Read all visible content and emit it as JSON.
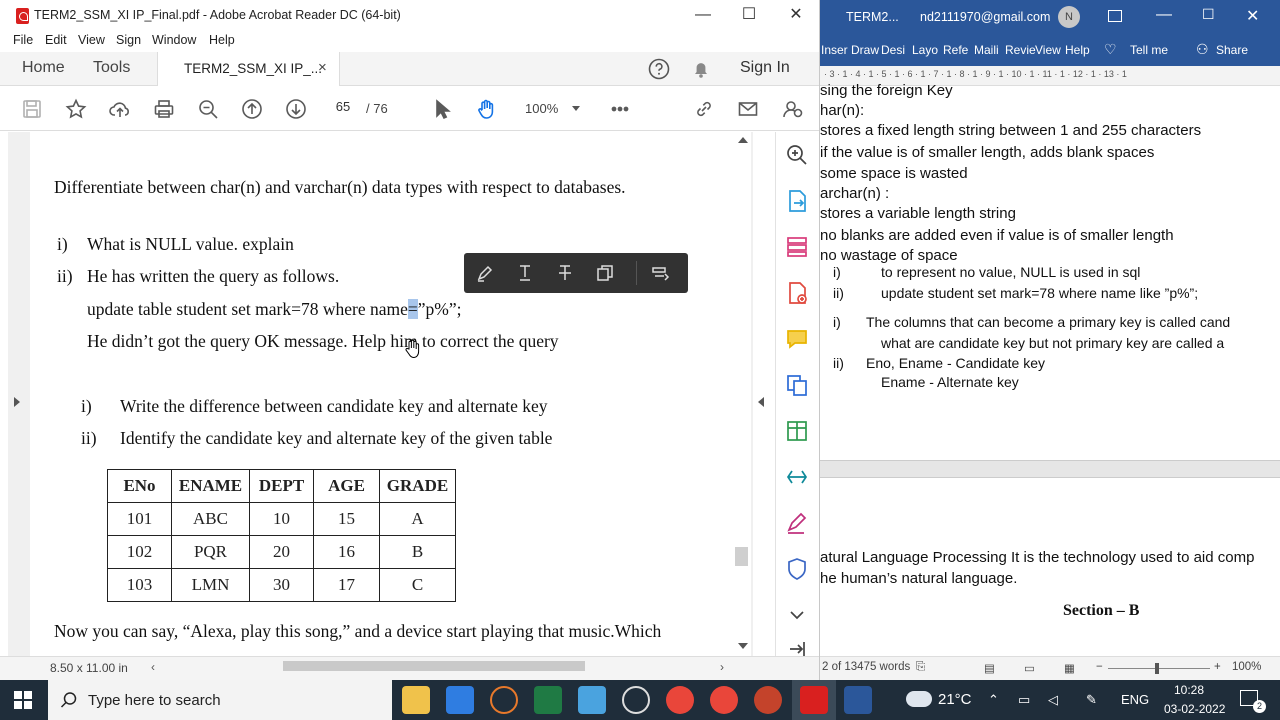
{
  "acrobat": {
    "title": "TERM2_SSM_XI IP_Final.pdf - Adobe Acrobat Reader DC (64-bit)",
    "menu": [
      "File",
      "Edit",
      "View",
      "Sign",
      "Window",
      "Help"
    ],
    "tabs": {
      "home": "Home",
      "tools": "Tools",
      "doc": "TERM2_SSM_XI IP_...",
      "close": "×"
    },
    "sign_in": "Sign In",
    "page_current": "65",
    "page_total": "/ 76",
    "zoom": "100%",
    "page_size": "8.50 x 11.00 in",
    "window_controls": {
      "minimize": "—",
      "maximize": "☐",
      "close": "✕"
    }
  },
  "pdf": {
    "q_diff": "Differentiate between char(n) and varchar(n) data types with respect to databases.",
    "q_i": "i)",
    "q_i_text": "What is NULL value. explain",
    "q_ii": "ii)",
    "q_ii_text": "He has written the query as follows.",
    "q_query_a": "update table student set mark=78 where name",
    "q_query_eq": "=",
    "q_query_b": "”p%”;",
    "q_help": "He didn’t got the query OK message. Help him to correct the query",
    "q2_i": "i)",
    "q2_i_text": "Write the difference between candidate key and alternate key",
    "q2_ii": "ii)",
    "q2_ii_text": "Identify the candidate key and alternate key of the given table",
    "table": {
      "headers": [
        "ENo",
        "ENAME",
        "DEPT",
        "AGE",
        "GRADE"
      ],
      "rows": [
        [
          "101",
          "ABC",
          "10",
          "15",
          "A"
        ],
        [
          "102",
          "PQR",
          "20",
          "16",
          "B"
        ],
        [
          "103",
          "LMN",
          "30",
          "17",
          "C"
        ]
      ]
    },
    "q_alexa": "Now you can say, “Alexa, play this song,” and a device start playing that music.Which"
  },
  "word": {
    "title": "TERM2...",
    "account": "nd2111970@gmail.com",
    "avatar": "N",
    "ribbon": [
      "Inser",
      "Draw",
      "Desi",
      "Layo",
      "Refe",
      "Maili",
      "Revie",
      "View",
      "Help"
    ],
    "tell_me": "Tell me",
    "share": "Share",
    "ruler": "· 3 · 1 · 4 · 1 · 5 · 1 · 6 · 1 · 7 · 1 · 8 · 1 · 9 · 1 · 10 · 1 · 11 · 1 · 12 · 1 · 13 · 1",
    "lines": {
      "l1": "sing the foreign Key",
      "l2": "har(n):",
      "l3": "stores a fixed length string between 1 and 255 characters",
      "l4": "if the value is of smaller length, adds blank spaces",
      "l5": "some space is wasted",
      "l6": "archar(n) :",
      "l7": "stores a variable length string",
      "l8": "no blanks are added even if value is of smaller length",
      "l9": "no wastage of space",
      "a1n": "i)",
      "a1": "to represent no value, NULL is used in sql",
      "a2n": "ii)",
      "a2": "update student set mark=78 where name like ”p%”;",
      "b1n": "i)",
      "b1": "The columns that can become a primary key is called cand",
      "b1b": "what are candidate key but not primary key are called a",
      "b2n": "ii)",
      "b2": "Eno, Ename - Candidate key",
      "b2b": "Ename - Alternate key",
      "nlp1": "atural Language Processing It is the technology used to aid comp",
      "nlp2": "he human’s natural language.",
      "section": "Section – B"
    },
    "status_words": "2 of 13475 words",
    "status_zoom": "100%"
  },
  "taskbar": {
    "search_placeholder": "Type here to search",
    "temperature": "21°C",
    "lang": "ENG",
    "time": "10:28",
    "date": "03-02-2022",
    "notifications": "2"
  }
}
